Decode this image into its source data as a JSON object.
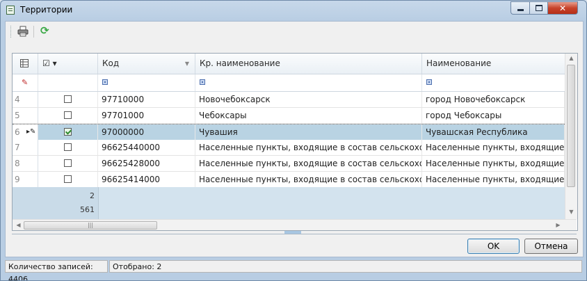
{
  "window": {
    "title": "Территории",
    "minimize_glyph": "",
    "close_glyph": "✕"
  },
  "toolbar": {
    "print_icon": "printer-icon",
    "refresh_icon": "refresh-icon",
    "refresh_glyph": "⟳"
  },
  "grid": {
    "columns": [
      {
        "label": ""
      },
      {
        "label": "☑ ▾"
      },
      {
        "label": "Код"
      },
      {
        "label": "Кр. наименование"
      },
      {
        "label": "Наименование"
      }
    ],
    "rows": [
      {
        "num": "4",
        "checked": false,
        "code": "97710000",
        "short": "Новочебоксарск",
        "name": "город Новочебоксарск"
      },
      {
        "num": "5",
        "checked": false,
        "code": "97701000",
        "short": "Чебоксары",
        "name": "город Чебоксары"
      },
      {
        "num": "6",
        "checked": true,
        "code": "97000000",
        "short": "Чувашия",
        "name": "Чувашская Республика"
      },
      {
        "num": "7",
        "checked": false,
        "code": "96625440000",
        "short": "Населенные  пункты,  входящие  в  состав  сельскохоз",
        "name": "Населенные  пункты,  входящие  в  состав"
      },
      {
        "num": "8",
        "checked": false,
        "code": "96625428000",
        "short": "Населенные  пункты,  входящие  в  состав  сельскохоз",
        "name": "Населенные  пункты,  входящие  в  состав"
      },
      {
        "num": "9",
        "checked": false,
        "code": "96625414000",
        "short": "Населенные  пункты,  входящие  в  состав  сельскохоз",
        "name": "Населенные  пункты,  входящие  в  состав"
      }
    ],
    "footer_values": [
      "2",
      "561"
    ],
    "scroll_up": "▲",
    "scroll_down": "▼",
    "scroll_left": "◀",
    "scroll_right": "▶",
    "hthumb_grip": "|||"
  },
  "buttons": {
    "ok": "OK",
    "cancel": "Отмена"
  },
  "status": {
    "records": "Количество записей: 4406",
    "selected": "Отобрано: 2"
  }
}
